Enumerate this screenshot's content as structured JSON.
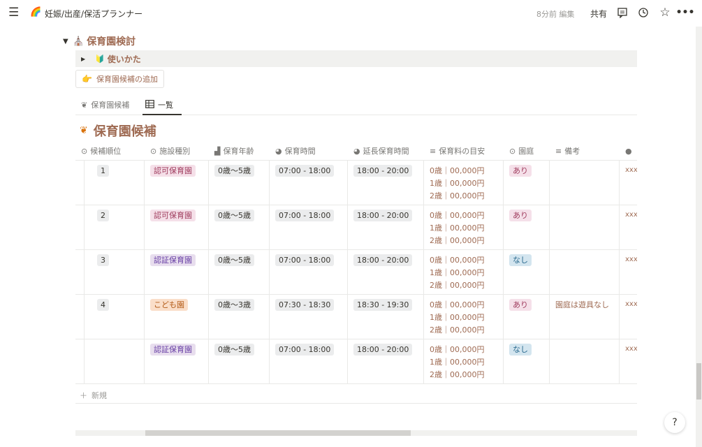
{
  "topbar": {
    "breadcrumb": "妊娠/出産/保活プランナー",
    "edited": "8分前 編集",
    "share": "共有"
  },
  "section": {
    "title": "保育園検討",
    "toggle_label": "使いかた",
    "add_button": "保育園候補の追加"
  },
  "tabs": [
    {
      "label": "保育園候補"
    },
    {
      "label": "一覧"
    }
  ],
  "database": {
    "title": "保育園候補",
    "columns": [
      "候補順位",
      "施設種別",
      "保育年齢",
      "保育時間",
      "延長保育時間",
      "保育料の目安",
      "園庭",
      "備考"
    ],
    "rows": [
      {
        "rank": "1",
        "type": "認可保育園",
        "type_color": "pink",
        "age": "0歳〜5歳",
        "hours": "07:00 - 18:00",
        "ext": "18:00 - 20:00",
        "fee": [
          "0歳｜00,000円",
          "1歳｜00,000円",
          "2歳｜00,000円"
        ],
        "yard": "あり",
        "yard_color": "pink",
        "note": "",
        "extra": "xxx"
      },
      {
        "rank": "2",
        "type": "認可保育園",
        "type_color": "pink",
        "age": "0歳〜5歳",
        "hours": "07:00 - 18:00",
        "ext": "18:00 - 20:00",
        "fee": [
          "0歳｜00,000円",
          "1歳｜00,000円",
          "2歳｜00,000円"
        ],
        "yard": "あり",
        "yard_color": "pink",
        "note": "",
        "extra": "xxx"
      },
      {
        "rank": "3",
        "type": "認証保育園",
        "type_color": "purple",
        "age": "0歳〜5歳",
        "hours": "07:00 - 18:00",
        "ext": "18:00 - 20:00",
        "fee": [
          "0歳｜00,000円",
          "1歳｜00,000円",
          "2歳｜00,000円"
        ],
        "yard": "なし",
        "yard_color": "blue",
        "note": "",
        "extra": "xxx"
      },
      {
        "rank": "4",
        "type": "こども園",
        "type_color": "orange",
        "age": "0歳〜3歳",
        "hours": "07:30 - 18:30",
        "ext": "18:30 - 19:30",
        "fee": [
          "0歳｜00,000円",
          "1歳｜00,000円",
          "2歳｜00,000円"
        ],
        "yard": "あり",
        "yard_color": "pink",
        "note": "園庭は遊具なし",
        "extra": "xxx"
      },
      {
        "rank": "",
        "type": "認証保育園",
        "type_color": "purple",
        "age": "0歳〜5歳",
        "hours": "07:00 - 18:00",
        "ext": "18:00 - 20:00",
        "fee": [
          "0歳｜00,000円",
          "1歳｜00,000円",
          "2歳｜00,000円"
        ],
        "yard": "なし",
        "yard_color": "blue",
        "note": "",
        "extra": "xxx"
      }
    ],
    "new_label": "新規"
  },
  "help_label": "?"
}
